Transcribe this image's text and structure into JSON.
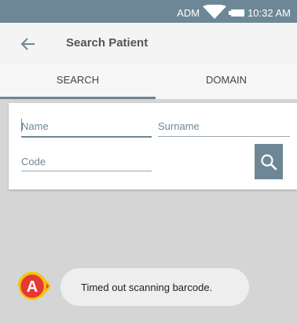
{
  "status_bar": {
    "carrier": "ADM",
    "time": "10:32 AM"
  },
  "app_bar": {
    "title": "Search Patient"
  },
  "tabs": [
    {
      "label": "SEARCH",
      "active": true
    },
    {
      "label": "DOMAIN",
      "active": false
    }
  ],
  "form": {
    "name_placeholder": "Name",
    "surname_placeholder": "Surname",
    "code_placeholder": "Code"
  },
  "toast": {
    "message": "Timed out scanning barcode."
  },
  "callout": {
    "label": "A"
  },
  "colors": {
    "primary": "#6d8796",
    "background": "#d5d5d5",
    "callout": "#e53935"
  }
}
